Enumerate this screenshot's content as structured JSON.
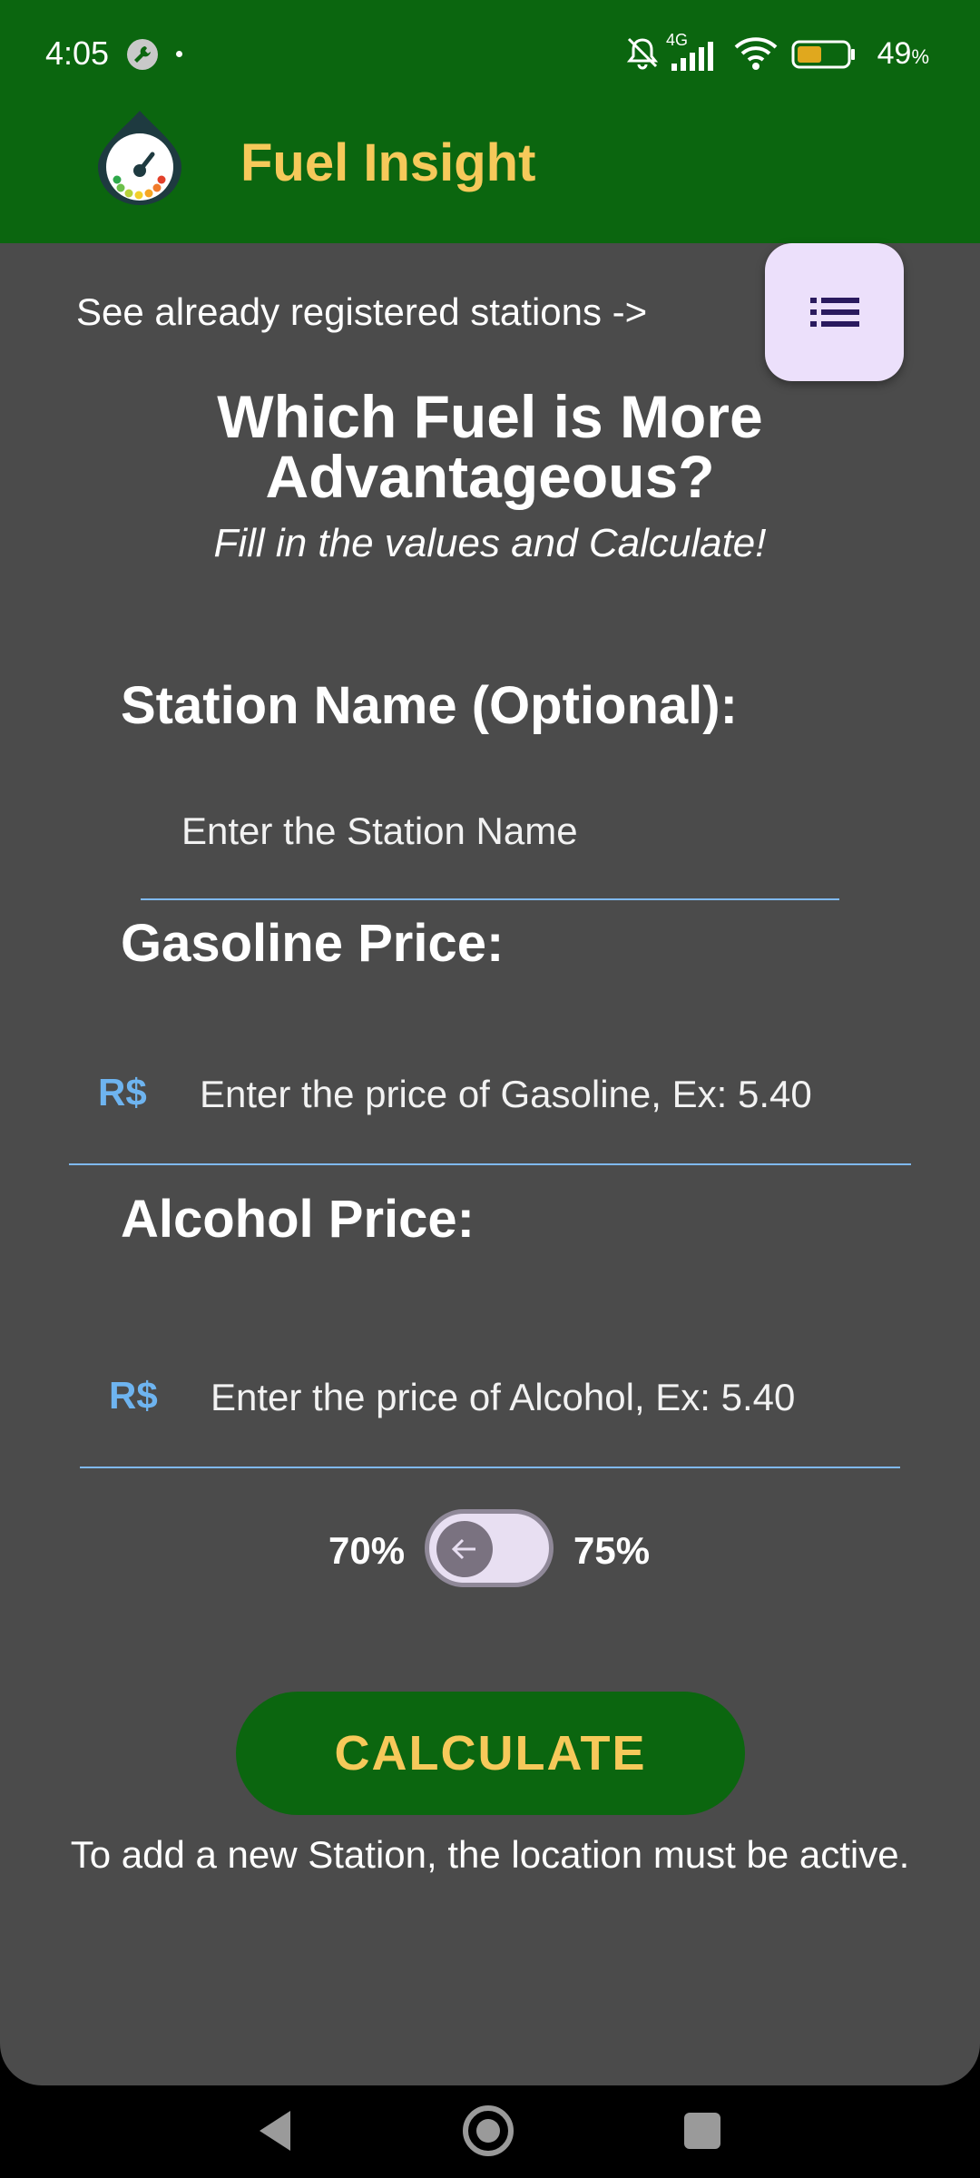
{
  "status_bar": {
    "time": "4:05",
    "battery_percent": "49",
    "battery_unit": "%",
    "network": "4G"
  },
  "app_bar": {
    "title": "Fuel Insight",
    "logo_icon": "gauge-drop-logo"
  },
  "main": {
    "see_stations_text": "See already registered stations ->",
    "list_button_icon": "list-icon",
    "heading_line1": "Which Fuel is More",
    "heading_line2": "Advantageous?",
    "subheading": "Fill in the values and Calculate!",
    "station": {
      "label": "Station Name (Optional):",
      "placeholder": "Enter the Station Name",
      "value": ""
    },
    "gasoline": {
      "label": "Gasoline Price:",
      "prefix": "R$",
      "placeholder": "Enter the price of Gasoline, Ex: 5.40",
      "value": ""
    },
    "alcohol": {
      "label": "Alcohol Price:",
      "prefix": "R$",
      "placeholder": "Enter the price of Alcohol, Ex: 5.40",
      "value": ""
    },
    "ratio_toggle": {
      "left_label": "70%",
      "right_label": "75%",
      "selected": "70%"
    },
    "calculate_label": "CALCULATE",
    "note": "To add a new Station, the location must be active."
  },
  "colors": {
    "app_bar": "#0b660f",
    "title_accent": "#f6c95a",
    "panel": "#4b4b4b",
    "underline": "#7fb9f2",
    "fab": "#ece0fb"
  }
}
